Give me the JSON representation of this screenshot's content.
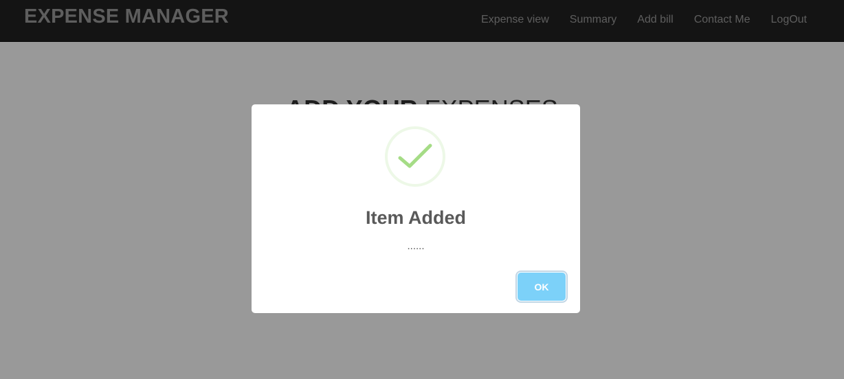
{
  "navbar": {
    "brand": "EXPENSE MANAGER",
    "links": [
      {
        "label": "Expense view"
      },
      {
        "label": "Summary"
      },
      {
        "label": "Add bill"
      },
      {
        "label": "Contact Me"
      },
      {
        "label": "LogOut"
      }
    ]
  },
  "main": {
    "heading_strong": "ADD YOUR",
    "heading_light": "EXPENSES"
  },
  "modal": {
    "icon": "success-check-icon",
    "title": "Item Added",
    "text": "......",
    "ok_label": "OK"
  },
  "colors": {
    "navbar_bg": "#222222",
    "nav_text": "#9d9d9d",
    "ok_button": "#7cd1f9",
    "success_check": "#a5dc86",
    "success_ring": "rgba(165, 220, 134, 0.2)"
  }
}
